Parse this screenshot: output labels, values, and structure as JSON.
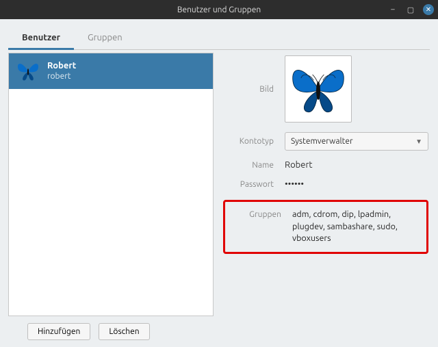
{
  "window": {
    "title": "Benutzer und Gruppen"
  },
  "tabs": {
    "users": "Benutzer",
    "groups": "Gruppen"
  },
  "users": [
    {
      "display": "Robert",
      "login": "robert"
    }
  ],
  "buttons": {
    "add": "Hinzufügen",
    "delete": "Löschen"
  },
  "details": {
    "image_label": "Bild",
    "account_type_label": "Kontotyp",
    "account_type_value": "Systemverwalter",
    "name_label": "Name",
    "name_value": "Robert",
    "password_label": "Passwort",
    "password_value": "••••••",
    "groups_label": "Gruppen",
    "groups_value": "adm, cdrom, dip, lpadmin, plugdev, sambashare, sudo, vboxusers"
  }
}
